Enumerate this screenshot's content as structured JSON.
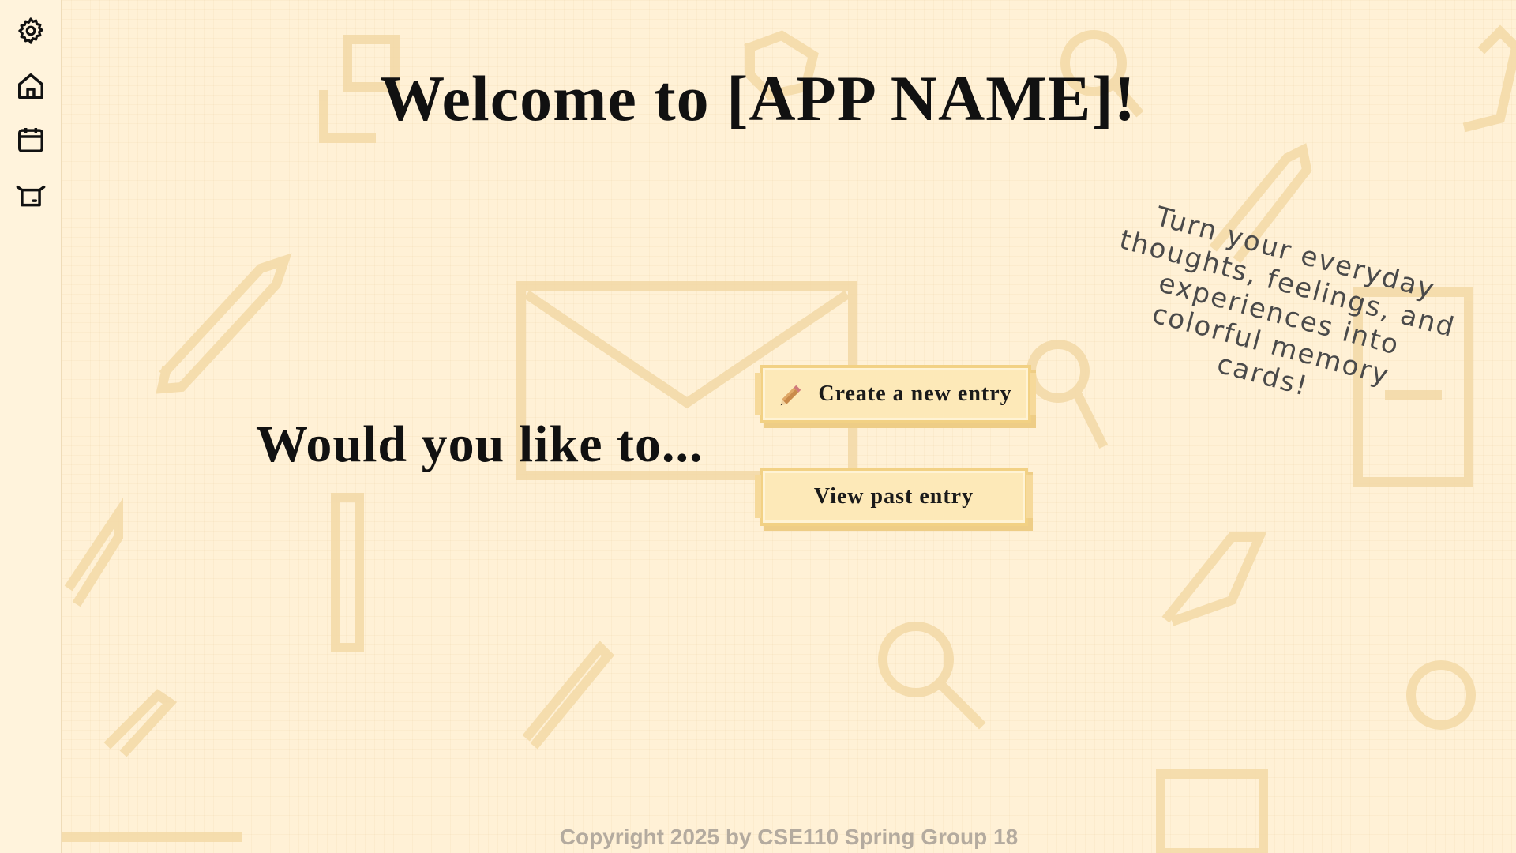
{
  "sidebar": {
    "items": [
      {
        "icon": "gear-icon"
      },
      {
        "icon": "home-icon"
      },
      {
        "icon": "calendar-icon"
      },
      {
        "icon": "basket-icon"
      }
    ]
  },
  "main": {
    "title": "Welcome to [APP NAME]!",
    "tagline": "Turn your everyday thoughts, feelings, and experiences into colorful memory cards!",
    "question": "Would you like to...",
    "create_button_label": "Create a new entry",
    "create_button_icon": "pencil-icon",
    "view_button_label": "View past entry"
  },
  "footer": {
    "copyright": "Copyright 2025 by CSE110 Spring Group 18"
  },
  "colors": {
    "background": "#fff1d6",
    "button_fill": "#fde9b8",
    "button_border": "#f2d184",
    "text": "#111111",
    "footer_text": "#b4ab9f"
  }
}
